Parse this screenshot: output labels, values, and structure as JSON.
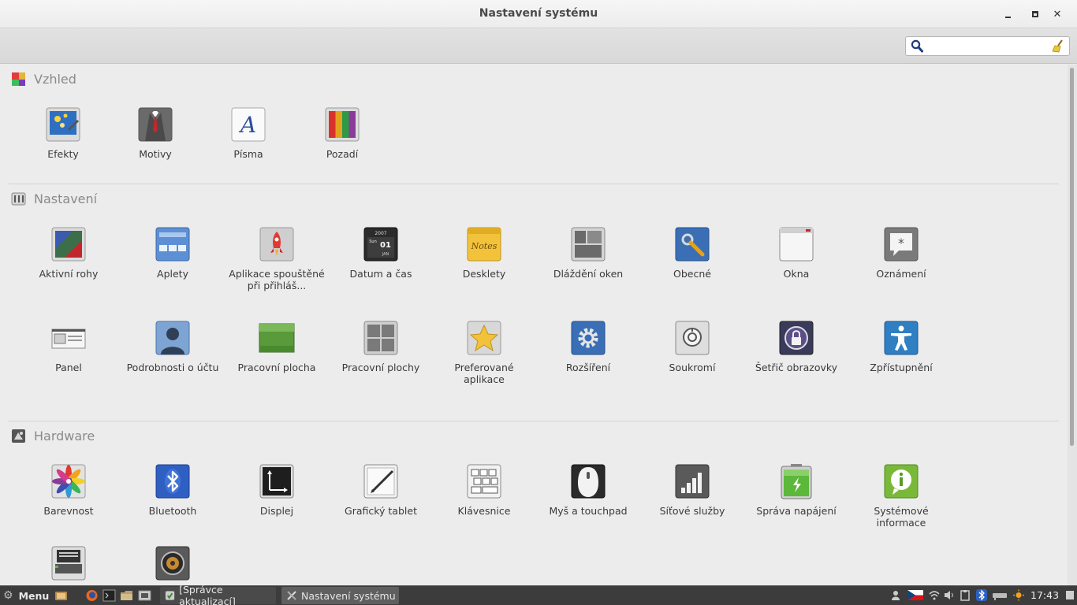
{
  "window": {
    "title": "Nastavení systému"
  },
  "search": {
    "value": "",
    "placeholder": ""
  },
  "sections": {
    "vzhled": {
      "title": "Vzhled",
      "items": [
        {
          "label": "Efekty",
          "icon": "effects-icon"
        },
        {
          "label": "Motivy",
          "icon": "themes-icon"
        },
        {
          "label": "Písma",
          "icon": "fonts-icon"
        },
        {
          "label": "Pozadí",
          "icon": "backgrounds-icon"
        }
      ]
    },
    "nastaveni": {
      "title": "Nastavení",
      "items": [
        {
          "label": "Aktivní rohy",
          "icon": "hot-corners-icon"
        },
        {
          "label": "Aplety",
          "icon": "applets-icon"
        },
        {
          "label": "Aplikace spouštěné při přihláš...",
          "icon": "startup-apps-icon"
        },
        {
          "label": "Datum a čas",
          "icon": "date-time-icon"
        },
        {
          "label": "Desklety",
          "icon": "desklets-icon"
        },
        {
          "label": "Dláždění oken",
          "icon": "window-tiling-icon"
        },
        {
          "label": "Obecné",
          "icon": "general-icon"
        },
        {
          "label": "Okna",
          "icon": "windows-icon"
        },
        {
          "label": "Oznámení",
          "icon": "notifications-icon"
        },
        {
          "label": "Panel",
          "icon": "panel-icon"
        },
        {
          "label": "Podrobnosti o účtu",
          "icon": "account-icon"
        },
        {
          "label": "Pracovní plocha",
          "icon": "desktop-icon"
        },
        {
          "label": "Pracovní plochy",
          "icon": "workspaces-icon"
        },
        {
          "label": "Preferované aplikace",
          "icon": "preferred-apps-icon"
        },
        {
          "label": "Rozšíření",
          "icon": "extensions-icon"
        },
        {
          "label": "Soukromí",
          "icon": "privacy-icon"
        },
        {
          "label": "Šetřič obrazovky",
          "icon": "screensaver-icon"
        },
        {
          "label": "Zpřístupnění",
          "icon": "accessibility-icon"
        }
      ]
    },
    "hardware": {
      "title": "Hardware",
      "items": [
        {
          "label": "Barevnost",
          "icon": "color-icon"
        },
        {
          "label": "Bluetooth",
          "icon": "bluetooth-icon"
        },
        {
          "label": "Displej",
          "icon": "display-icon"
        },
        {
          "label": "Grafický tablet",
          "icon": "tablet-icon"
        },
        {
          "label": "Klávesnice",
          "icon": "keyboard-icon"
        },
        {
          "label": "Myš a touchpad",
          "icon": "mouse-icon"
        },
        {
          "label": "Síťové služby",
          "icon": "network-icon"
        },
        {
          "label": "Správa napájení",
          "icon": "power-icon"
        },
        {
          "label": "Systémové informace",
          "icon": "system-info-icon"
        },
        {
          "label": "",
          "icon": "printer-icon"
        },
        {
          "label": "",
          "icon": "sound-icon"
        }
      ]
    }
  },
  "date_icon": {
    "year": "2007",
    "day_name": "Sun",
    "day": "01",
    "month": "JAN"
  },
  "desklets_icon_text": "Notes",
  "taskbar": {
    "menu_label": "Menu",
    "tasks": [
      {
        "label": "[Správce aktualizací]"
      },
      {
        "label": "Nastavení systému"
      }
    ],
    "clock": "17:43"
  }
}
